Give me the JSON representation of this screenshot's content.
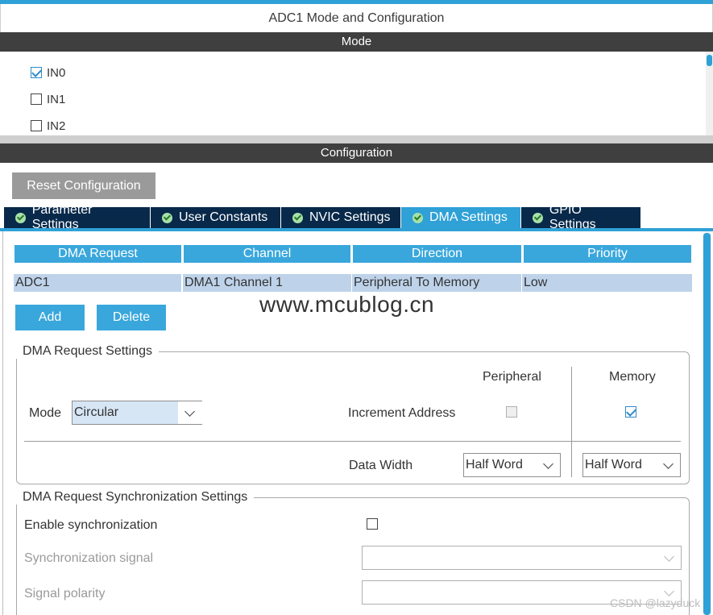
{
  "window": {
    "title": "ADC1 Mode and Configuration"
  },
  "mode_section": {
    "label": "Mode",
    "inputs": [
      {
        "label": "IN0",
        "checked": true
      },
      {
        "label": "IN1",
        "checked": false
      },
      {
        "label": "IN2",
        "checked": false
      }
    ]
  },
  "config_section": {
    "label": "Configuration",
    "reset_label": "Reset Configuration",
    "tabs": [
      {
        "label": "Parameter Settings",
        "active": false
      },
      {
        "label": "User Constants",
        "active": false
      },
      {
        "label": "NVIC Settings",
        "active": false
      },
      {
        "label": "DMA Settings",
        "active": true
      },
      {
        "label": "GPIO Settings",
        "active": false
      }
    ]
  },
  "dma_table": {
    "headers": [
      "DMA Request",
      "Channel",
      "Direction",
      "Priority"
    ],
    "rows": [
      [
        "ADC1",
        "DMA1 Channel 1",
        "Peripheral To Memory",
        "Low"
      ]
    ]
  },
  "actions": {
    "add_label": "Add",
    "delete_label": "Delete"
  },
  "watermark": "www.mcublog.cn",
  "request_settings": {
    "title": "DMA Request Settings",
    "col_peripheral": "Peripheral",
    "col_memory": "Memory",
    "mode_label": "Mode",
    "mode_value": "Circular",
    "increment_label": "Increment Address",
    "increment_peripheral": false,
    "increment_memory": true,
    "data_width_label": "Data Width",
    "data_width_peripheral": "Half Word",
    "data_width_memory": "Half Word"
  },
  "sync_settings": {
    "title": "DMA Request Synchronization Settings",
    "enable_label": "Enable synchronization",
    "enable_checked": false,
    "signal_label": "Synchronization signal",
    "polarity_label": "Signal polarity"
  },
  "footer_watermark": "CSDN @lazyduck",
  "colors": {
    "accent": "#2fa1d6",
    "tab_dark": "#08294a",
    "row_selected": "#bed3ea",
    "section_bar": "#3f3f3f"
  }
}
